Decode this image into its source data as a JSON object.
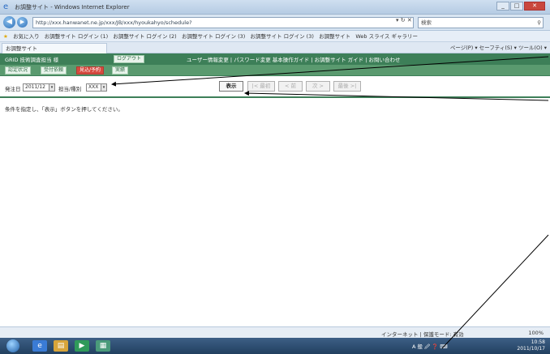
{
  "browser": {
    "title": "お調整サイト - Windows Internet Explorer",
    "address": "http://xxx.hanwanet.ne.jp/xxx/JB/xxx/hyoukahyo/schedule?",
    "search_placeholder": "検索",
    "favorites": [
      "お気に入り",
      "お調整サイト ログイン (1)",
      "お調整サイト ログイン (2)",
      "お調整サイト ログイン (3)",
      "お調整サイト ログイン (3)",
      "お調整サイト",
      "Web スライス ギャラリー"
    ],
    "tab_title": "お調整サイト",
    "toolbar_right": "ページ(P) ▾  セーフティ(S) ▾  ツール(O) ▾",
    "window_buttons": [
      "_",
      "□",
      "✕"
    ]
  },
  "app": {
    "system_name": "GRID 技術調査担当 様",
    "logout_label": "ログアウト",
    "header_links": "ユーザー情報変更 | パスワード変更  基本操作ガイド | お調整サイト ガイド | お問い合わせ",
    "nav": [
      {
        "label": "認定状況",
        "active": false
      },
      {
        "label": "受付依頼",
        "active": false
      },
      {
        "label": "見込/予約",
        "active": true
      },
      {
        "label": "実績",
        "active": false
      }
    ]
  },
  "filters": {
    "period_label": "発注日",
    "period_value": "2011/12",
    "category_label": "担当/種別",
    "category_value": "XXX"
  },
  "buttons": {
    "display": "表示",
    "first": "|< 最初",
    "prev": "< 前",
    "next": "次 >",
    "last": "最後 >|"
  },
  "message": "条件を指定し、「表示」ボタンを押してください。",
  "status": {
    "zone": "インターネット | 保護モード: 有効",
    "zoom": "100%"
  },
  "taskbar": {
    "tray": "A 般 🖉 ❓ ⌨",
    "time": "10:58",
    "date": "2011/10/17"
  }
}
